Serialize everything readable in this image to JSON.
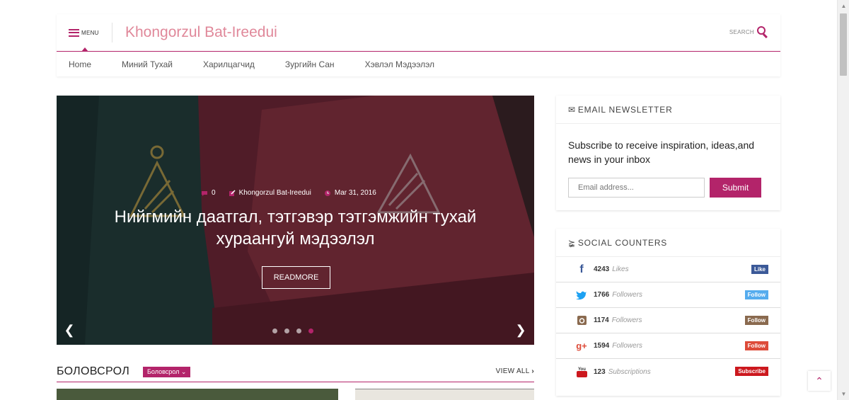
{
  "header": {
    "menu_label": "MENU",
    "site_title": "Khongorzul Bat-Ireedui",
    "search_label": "SEARCH"
  },
  "nav": {
    "items": [
      "Home",
      "Миний Тухай",
      "Харилцагчид",
      "Зургийн Сан",
      "Хэвлэл Мэдээлэл"
    ]
  },
  "hero": {
    "comments": "0",
    "author": "Khongorzul Bat-Ireedui",
    "date": "Mar 31, 2016",
    "title": "Нийгмийн даатгал, тэтгэвэр тэтгэмжийн тухай хураангуй мэдээлэл",
    "readmore": "READMORE",
    "slides_total": 4,
    "active_slide": 4
  },
  "section": {
    "title": "БОЛОВСРОЛ",
    "category_tag": "Боловсрол",
    "view_all": "VIEW ALL"
  },
  "newsletter": {
    "heading": "EMAIL NEWSLETTER",
    "text": "Subscribe to receive inspiration, ideas,and news in your inbox",
    "placeholder": "Email address...",
    "button": "Submit"
  },
  "social": {
    "heading": "SOCIAL COUNTERS",
    "items": [
      {
        "icon": "facebook-icon",
        "glyph": "f",
        "color": "#3b5998",
        "count": "4243",
        "unit": "Likes",
        "button": "Like",
        "btn_color": "#3b5998"
      },
      {
        "icon": "twitter-icon",
        "glyph": "t",
        "color": "#1da1f2",
        "count": "1766",
        "unit": "Followers",
        "button": "Follow",
        "btn_color": "#55acee"
      },
      {
        "icon": "instagram-icon",
        "glyph": "i",
        "color": "#8a6a4f",
        "count": "1174",
        "unit": "Followers",
        "button": "Follow",
        "btn_color": "#8a6a4f"
      },
      {
        "icon": "google-plus-icon",
        "glyph": "g+",
        "color": "#dd4b39",
        "count": "1594",
        "unit": "Followers",
        "button": "Follow",
        "btn_color": "#dd4b39"
      },
      {
        "icon": "youtube-icon",
        "glyph": "yt",
        "color": "#cc181e",
        "count": "123",
        "unit": "Subscriptions",
        "button": "Subscribe",
        "btn_color": "#cc181e"
      }
    ]
  },
  "colors": {
    "accent": "#b3246a",
    "title_pink": "#e0889a"
  }
}
